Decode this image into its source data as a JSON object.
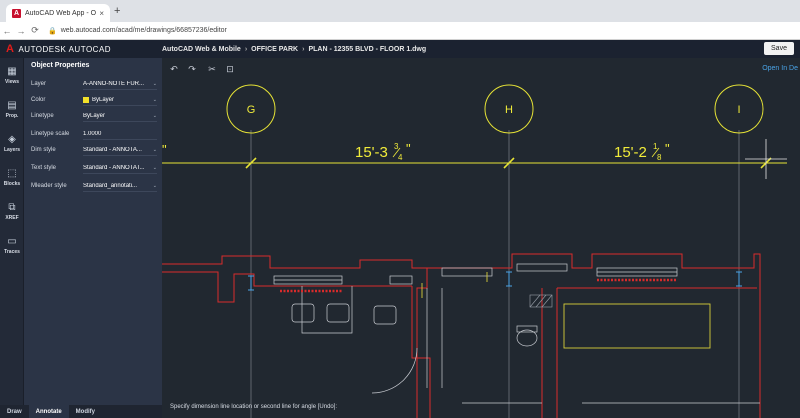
{
  "browser": {
    "tab_title": "AutoCAD Web App - Online CAD",
    "new_tab": "+",
    "close": "×",
    "url": "web.autocad.com/acad/me/drawings/66857236/editor"
  },
  "app": {
    "brand": "AUTODESK AUTOCAD",
    "logo": "A",
    "breadcrumb": [
      "AutoCAD Web & Mobile",
      "OFFICE PARK",
      "PLAN - 12355 BLVD - FLOOR 1.dwg"
    ],
    "breadcrumb_sep": "›",
    "save_label": "Save",
    "open_in_label": "Open In De"
  },
  "rail": [
    {
      "name": "views",
      "label": "Views",
      "icon": "▦"
    },
    {
      "name": "prop",
      "label": "Prop.",
      "icon": "▤"
    },
    {
      "name": "layers",
      "label": "Layers",
      "icon": "◈"
    },
    {
      "name": "blocks",
      "label": "Blocks",
      "icon": "⬚"
    },
    {
      "name": "xref",
      "label": "XREF",
      "icon": "⧉"
    },
    {
      "name": "traces",
      "label": "Traces",
      "icon": "▭"
    }
  ],
  "properties": {
    "title": "Object Properties",
    "rows": [
      {
        "label": "Layer",
        "value": "A-ANNO-NOTE FUR...",
        "dropdown": true
      },
      {
        "label": "Color",
        "value": "ByLayer",
        "dropdown": true,
        "swatch": "#f3e12a"
      },
      {
        "label": "Linetype",
        "value": "ByLayer",
        "dropdown": true
      },
      {
        "label": "Linetype scale",
        "value": "1.0000",
        "dropdown": false
      },
      {
        "label": "Dim style",
        "value": "Standard - ANNOTA...",
        "dropdown": true
      },
      {
        "label": "Text style",
        "value": "Standard - ANNOTAT...",
        "dropdown": true
      },
      {
        "label": "Mleader style",
        "value": "Standard_annotati...",
        "dropdown": true
      }
    ]
  },
  "bottom_tabs": [
    "Draw",
    "Annotate",
    "Modify"
  ],
  "bottom_active": "Annotate",
  "drawing": {
    "grid_labels": [
      "G",
      "H",
      "I"
    ],
    "dim_left_whole": "15'-3",
    "dim_left_num": "3",
    "dim_left_den": "4",
    "dim_right_whole": "15'-2",
    "dim_right_num": "1",
    "dim_right_den": "8",
    "inch_mark": "\"",
    "colors": {
      "canvas": "#212830",
      "grid_bubble": "#e6e336",
      "dimension": "#e6e336",
      "dim_text": "#f1ec3a",
      "walls_red": "#d92b2b",
      "walls_yellow": "#d8cf3a",
      "walls_white": "#c9ccd2",
      "grid_line": "#8a8f98"
    }
  },
  "command_line": "Specify dimension line location or second line for angle [Undo]:"
}
